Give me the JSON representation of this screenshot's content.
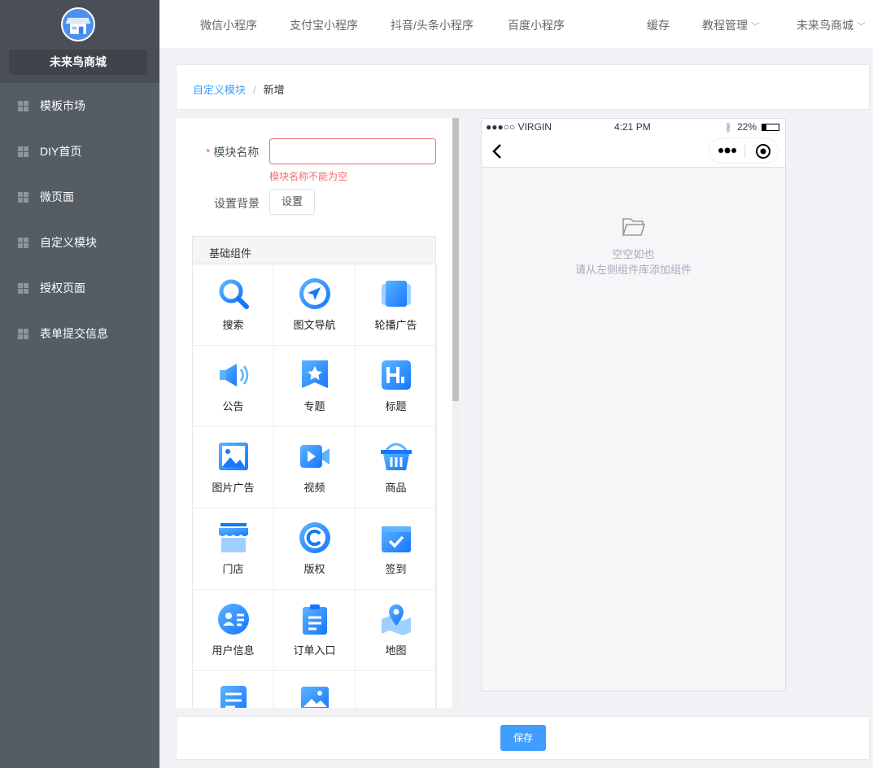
{
  "sidebar": {
    "shop_name": "未来鸟商城",
    "items": [
      {
        "label": "模板市场"
      },
      {
        "label": "DIY首页"
      },
      {
        "label": "微页面"
      },
      {
        "label": "自定义模块"
      },
      {
        "label": "授权页面"
      },
      {
        "label": "表单提交信息"
      }
    ]
  },
  "topbar": {
    "items": [
      "微信小程序",
      "支付宝小程序",
      "抖音/头条小程序",
      "百度小程序"
    ],
    "cache": "缓存",
    "tutorial": "教程管理",
    "shop": "未来鸟商城"
  },
  "breadcrumb": {
    "parent": "自定义模块",
    "sep": "/",
    "current": "新增"
  },
  "form": {
    "required_mark": "*",
    "name_label": "模块名称",
    "name_value": "",
    "name_error": "模块名称不能为空",
    "bg_label": "设置背景",
    "bg_button": "设置"
  },
  "components": {
    "title": "基础组件",
    "items": [
      {
        "label": "搜索",
        "icon": "search"
      },
      {
        "label": "图文导航",
        "icon": "navigation"
      },
      {
        "label": "轮播广告",
        "icon": "carousel"
      },
      {
        "label": "公告",
        "icon": "speaker"
      },
      {
        "label": "专题",
        "icon": "star-bookmark"
      },
      {
        "label": "标题",
        "icon": "heading"
      },
      {
        "label": "图片广告",
        "icon": "image"
      },
      {
        "label": "视频",
        "icon": "video"
      },
      {
        "label": "商品",
        "icon": "basket"
      },
      {
        "label": "门店",
        "icon": "store"
      },
      {
        "label": "版权",
        "icon": "copyright"
      },
      {
        "label": "签到",
        "icon": "calendar-check"
      },
      {
        "label": "用户信息",
        "icon": "user-card"
      },
      {
        "label": "订单入口",
        "icon": "clipboard"
      },
      {
        "label": "地图",
        "icon": "map-pin"
      }
    ]
  },
  "phone": {
    "carrier": "●●●○○ VIRGIN",
    "time": "4:21 PM",
    "battery": "22%",
    "empty_title": "空空如也",
    "empty_hint": "请从左侧组件库添加组件"
  },
  "footer": {
    "save": "保存"
  }
}
